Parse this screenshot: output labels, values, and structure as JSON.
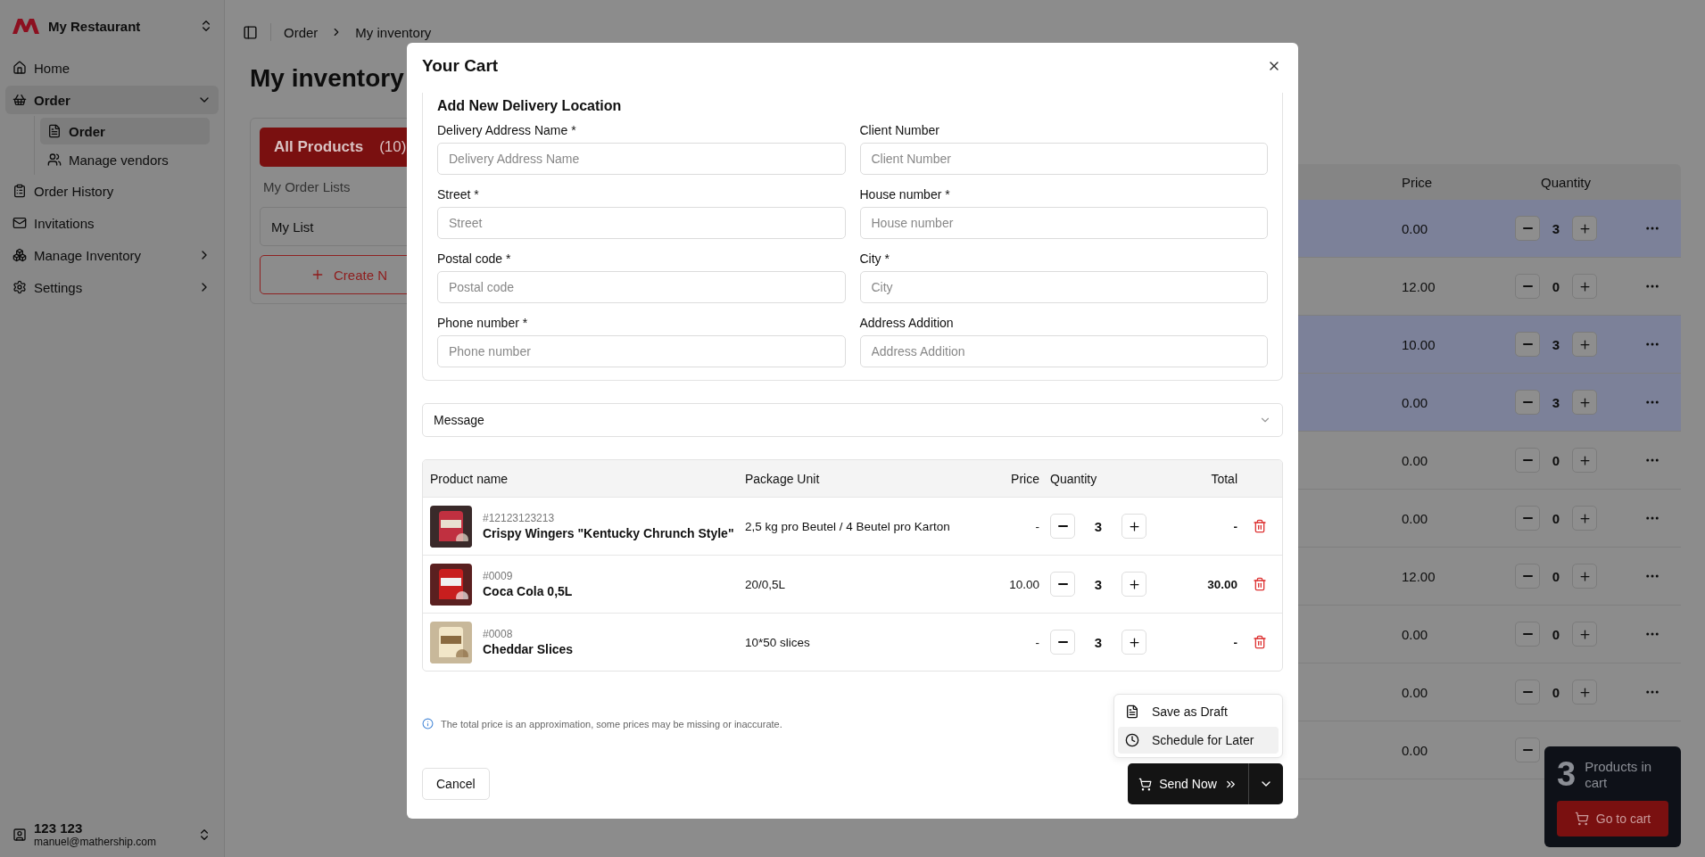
{
  "sidebar": {
    "workspace": "My Restaurant",
    "items": [
      {
        "label": "Home",
        "selected": false
      },
      {
        "label": "Order",
        "selected": true,
        "expanded": true,
        "children": [
          {
            "label": "Order",
            "selected": true
          },
          {
            "label": "Manage vendors",
            "selected": false
          }
        ]
      },
      {
        "label": "Order History",
        "selected": false
      },
      {
        "label": "Invitations",
        "selected": false
      },
      {
        "label": "Manage Inventory",
        "selected": false,
        "expanded": false
      },
      {
        "label": "Settings",
        "selected": false,
        "expanded": false
      }
    ],
    "user": {
      "name": "123 123",
      "email": "manuel@mathership.com"
    }
  },
  "breadcrumb": [
    "Order",
    "My inventory"
  ],
  "page_title": "My inventory",
  "lists_panel": {
    "tabs": [
      {
        "label": "All Products",
        "count": "(10)",
        "selected": true
      }
    ],
    "section_label": "My Order Lists",
    "lists": [
      {
        "label": "My List"
      }
    ],
    "create_button": "Create N"
  },
  "inventory_table": {
    "columns": [
      "Price",
      "Quantity"
    ],
    "rows": [
      {
        "price": "0.00",
        "quantity": "3",
        "selected": true
      },
      {
        "price": "12.00",
        "quantity": "0",
        "selected": false
      },
      {
        "price": "10.00",
        "quantity": "3",
        "selected": true
      },
      {
        "price": "0.00",
        "quantity": "3",
        "selected": true
      },
      {
        "price": "0.00",
        "quantity": "0",
        "selected": false
      },
      {
        "price": "0.00",
        "quantity": "0",
        "selected": false
      },
      {
        "price": "12.00",
        "quantity": "0",
        "selected": false
      },
      {
        "price": "0.00",
        "quantity": "0",
        "selected": false
      },
      {
        "price": "0.00",
        "quantity": "0",
        "selected": false
      },
      {
        "price": "0.00",
        "selected": false
      }
    ]
  },
  "cart_widget": {
    "count": "3",
    "label": "Products in cart",
    "button": "Go to cart"
  },
  "dialog": {
    "title": "Your Cart",
    "delivery_form": {
      "title": "Add New Delivery Location",
      "fields": [
        {
          "label": "Delivery Address Name *",
          "placeholder": "Delivery Address Name"
        },
        {
          "label": "Client Number",
          "placeholder": "Client Number"
        },
        {
          "label": "Street *",
          "placeholder": "Street"
        },
        {
          "label": "House number *",
          "placeholder": "House number"
        },
        {
          "label": "Postal code *",
          "placeholder": "Postal code"
        },
        {
          "label": "City *",
          "placeholder": "City"
        },
        {
          "label": "Phone number *",
          "placeholder": "Phone number"
        },
        {
          "label": "Address Addition",
          "placeholder": "Address Addition"
        }
      ]
    },
    "message": {
      "label": "Message",
      "expanded": false
    },
    "cart_table": {
      "columns": [
        "Product name",
        "Package Unit",
        "Price",
        "Quantity",
        "Total"
      ],
      "rows": [
        {
          "sku": "#12123123213",
          "name": "Crispy Wingers \"Kentucky Chrunch Style\"",
          "unit": "2,5 kg pro Beutel / 4 Beutel pro Karton",
          "price": "-",
          "quantity": "3",
          "total": "-"
        },
        {
          "sku": "#0009",
          "name": "Coca Cola 0,5L",
          "unit": "20/0,5L",
          "price": "10.00",
          "quantity": "3",
          "total": "30.00"
        },
        {
          "sku": "#0008",
          "name": "Cheddar Slices",
          "unit": "10*50 slices",
          "price": "-",
          "quantity": "3",
          "total": "-"
        }
      ]
    },
    "note": "The total price is an approximation, some prices may be missing or inaccurate.",
    "cancel": "Cancel",
    "send": "Send Now",
    "menu": [
      {
        "label": "Save as Draft",
        "selected": false
      },
      {
        "label": "Schedule for Later",
        "selected": true
      }
    ]
  }
}
